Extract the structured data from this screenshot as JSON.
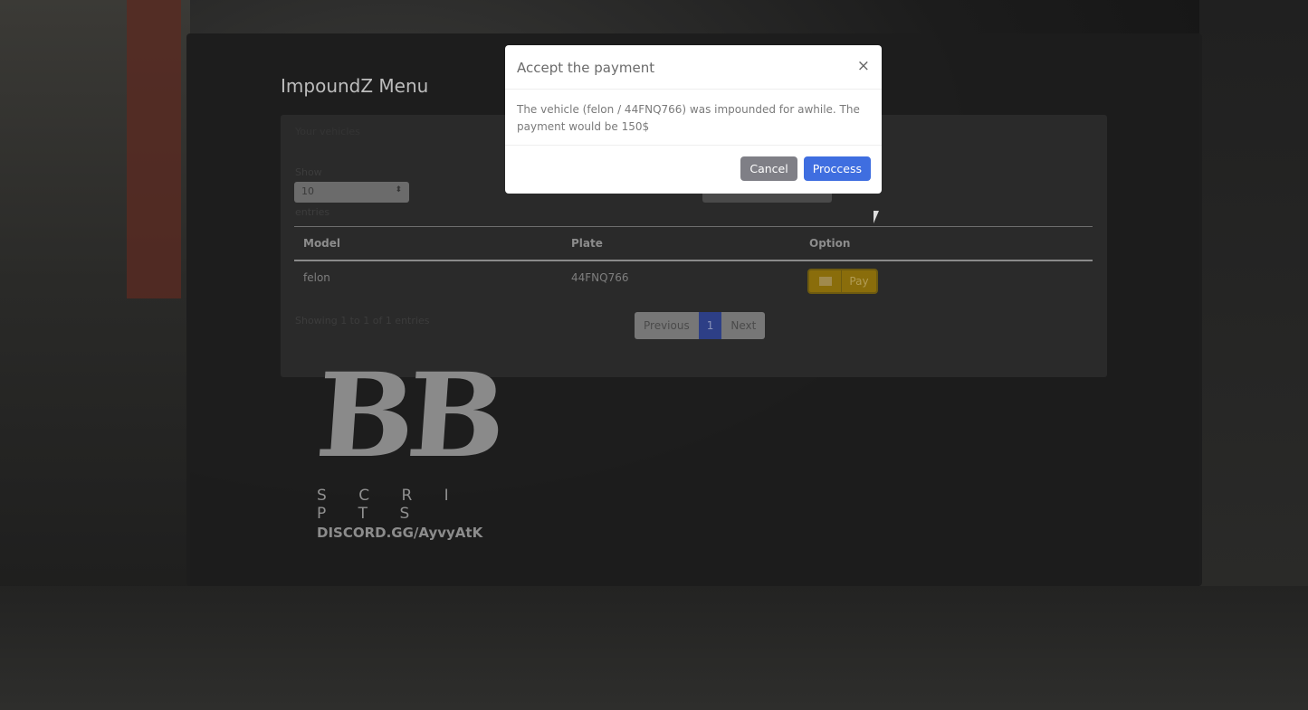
{
  "app": {
    "title": "ImpoundZ Menu"
  },
  "card": {
    "header": "Your vehicles",
    "show_label": "Show",
    "entries_select": "10",
    "entries_label": "entries"
  },
  "table": {
    "columns": [
      "Model",
      "Plate",
      "Option"
    ],
    "rows": [
      {
        "model": "felon",
        "plate": "44FNQ766",
        "option": "Pay"
      }
    ]
  },
  "pagination": {
    "info": "Showing 1 to 1 of 1 entries",
    "previous": "Previous",
    "current": "1",
    "next": "Next"
  },
  "modal": {
    "title": "Accept the payment",
    "close": "×",
    "body": "The vehicle (felon / 44FNQ766) was impounded for awhile. The payment would be 150$",
    "cancel": "Cancel",
    "process": "Proccess"
  },
  "watermark": {
    "logo": "BB",
    "sub": "S C R I P T S",
    "discord": "DISCORD.GG/AyvyAtK"
  },
  "colors": {
    "process": "#3f6ee0",
    "cancel": "#7f7f86",
    "pay": "#8a6d0b",
    "page_active": "#2d3f86"
  }
}
